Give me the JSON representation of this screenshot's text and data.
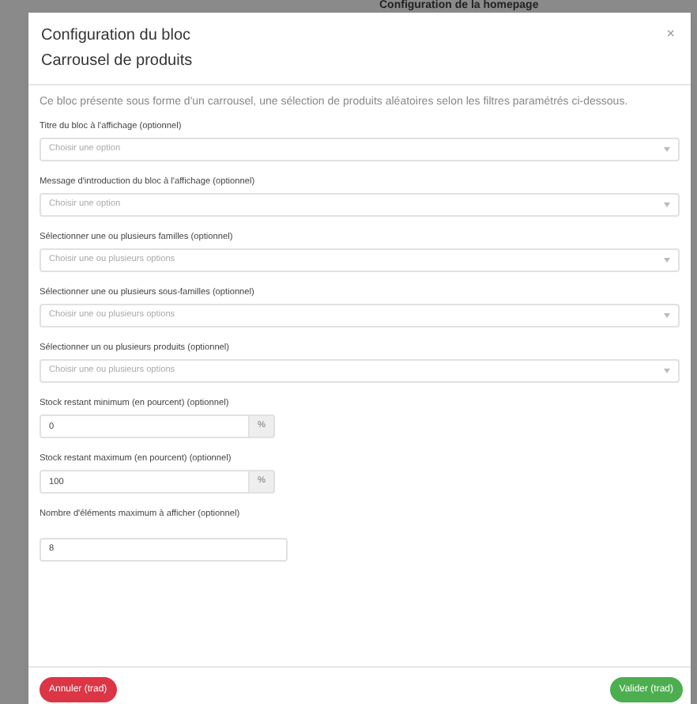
{
  "backdrop_title": "Configuration de la homepage",
  "modal": {
    "title_lines": [
      "Configuration du bloc",
      "Carrousel de produits"
    ],
    "close": "×",
    "description": "Ce bloc présente sous forme d'un carrousel, une sélection de produits aléatoires selon les filtres paramétrés ci-dessous.",
    "fields": [
      {
        "kind": "select",
        "label": "Titre du bloc à l'affichage (optionnel)",
        "placeholder": "Choisir une option"
      },
      {
        "kind": "select",
        "label": "Message d'introduction du bloc à l'affichage (optionnel)",
        "placeholder": "Choisir une option"
      },
      {
        "kind": "select",
        "label": "Sélectionner une ou plusieurs familles (optionnel)",
        "placeholder": "Choisir une ou plusieurs options"
      },
      {
        "kind": "select",
        "label": "Sélectionner une ou plusieurs sous-familles (optionnel)",
        "placeholder": "Choisir une ou plusieurs options"
      },
      {
        "kind": "select",
        "label": "Sélectionner un ou plusieurs produits (optionnel)",
        "placeholder": "Choisir une ou plusieurs options"
      },
      {
        "kind": "addon",
        "label": "Stock restant minimum (en pourcent) (optionnel)",
        "value": "0",
        "addon": "%"
      },
      {
        "kind": "addon",
        "label": "Stock restant maximum (en pourcent) (optionnel)",
        "value": "100",
        "addon": "%"
      },
      {
        "kind": "input",
        "label": "Nombre d'éléments maximum à afficher (optionnel)",
        "value": "8"
      }
    ],
    "buttons": [
      {
        "kind": "cancel",
        "label": "Annuler (trad)"
      },
      {
        "kind": "submit",
        "label": "Valider (trad)"
      }
    ]
  }
}
